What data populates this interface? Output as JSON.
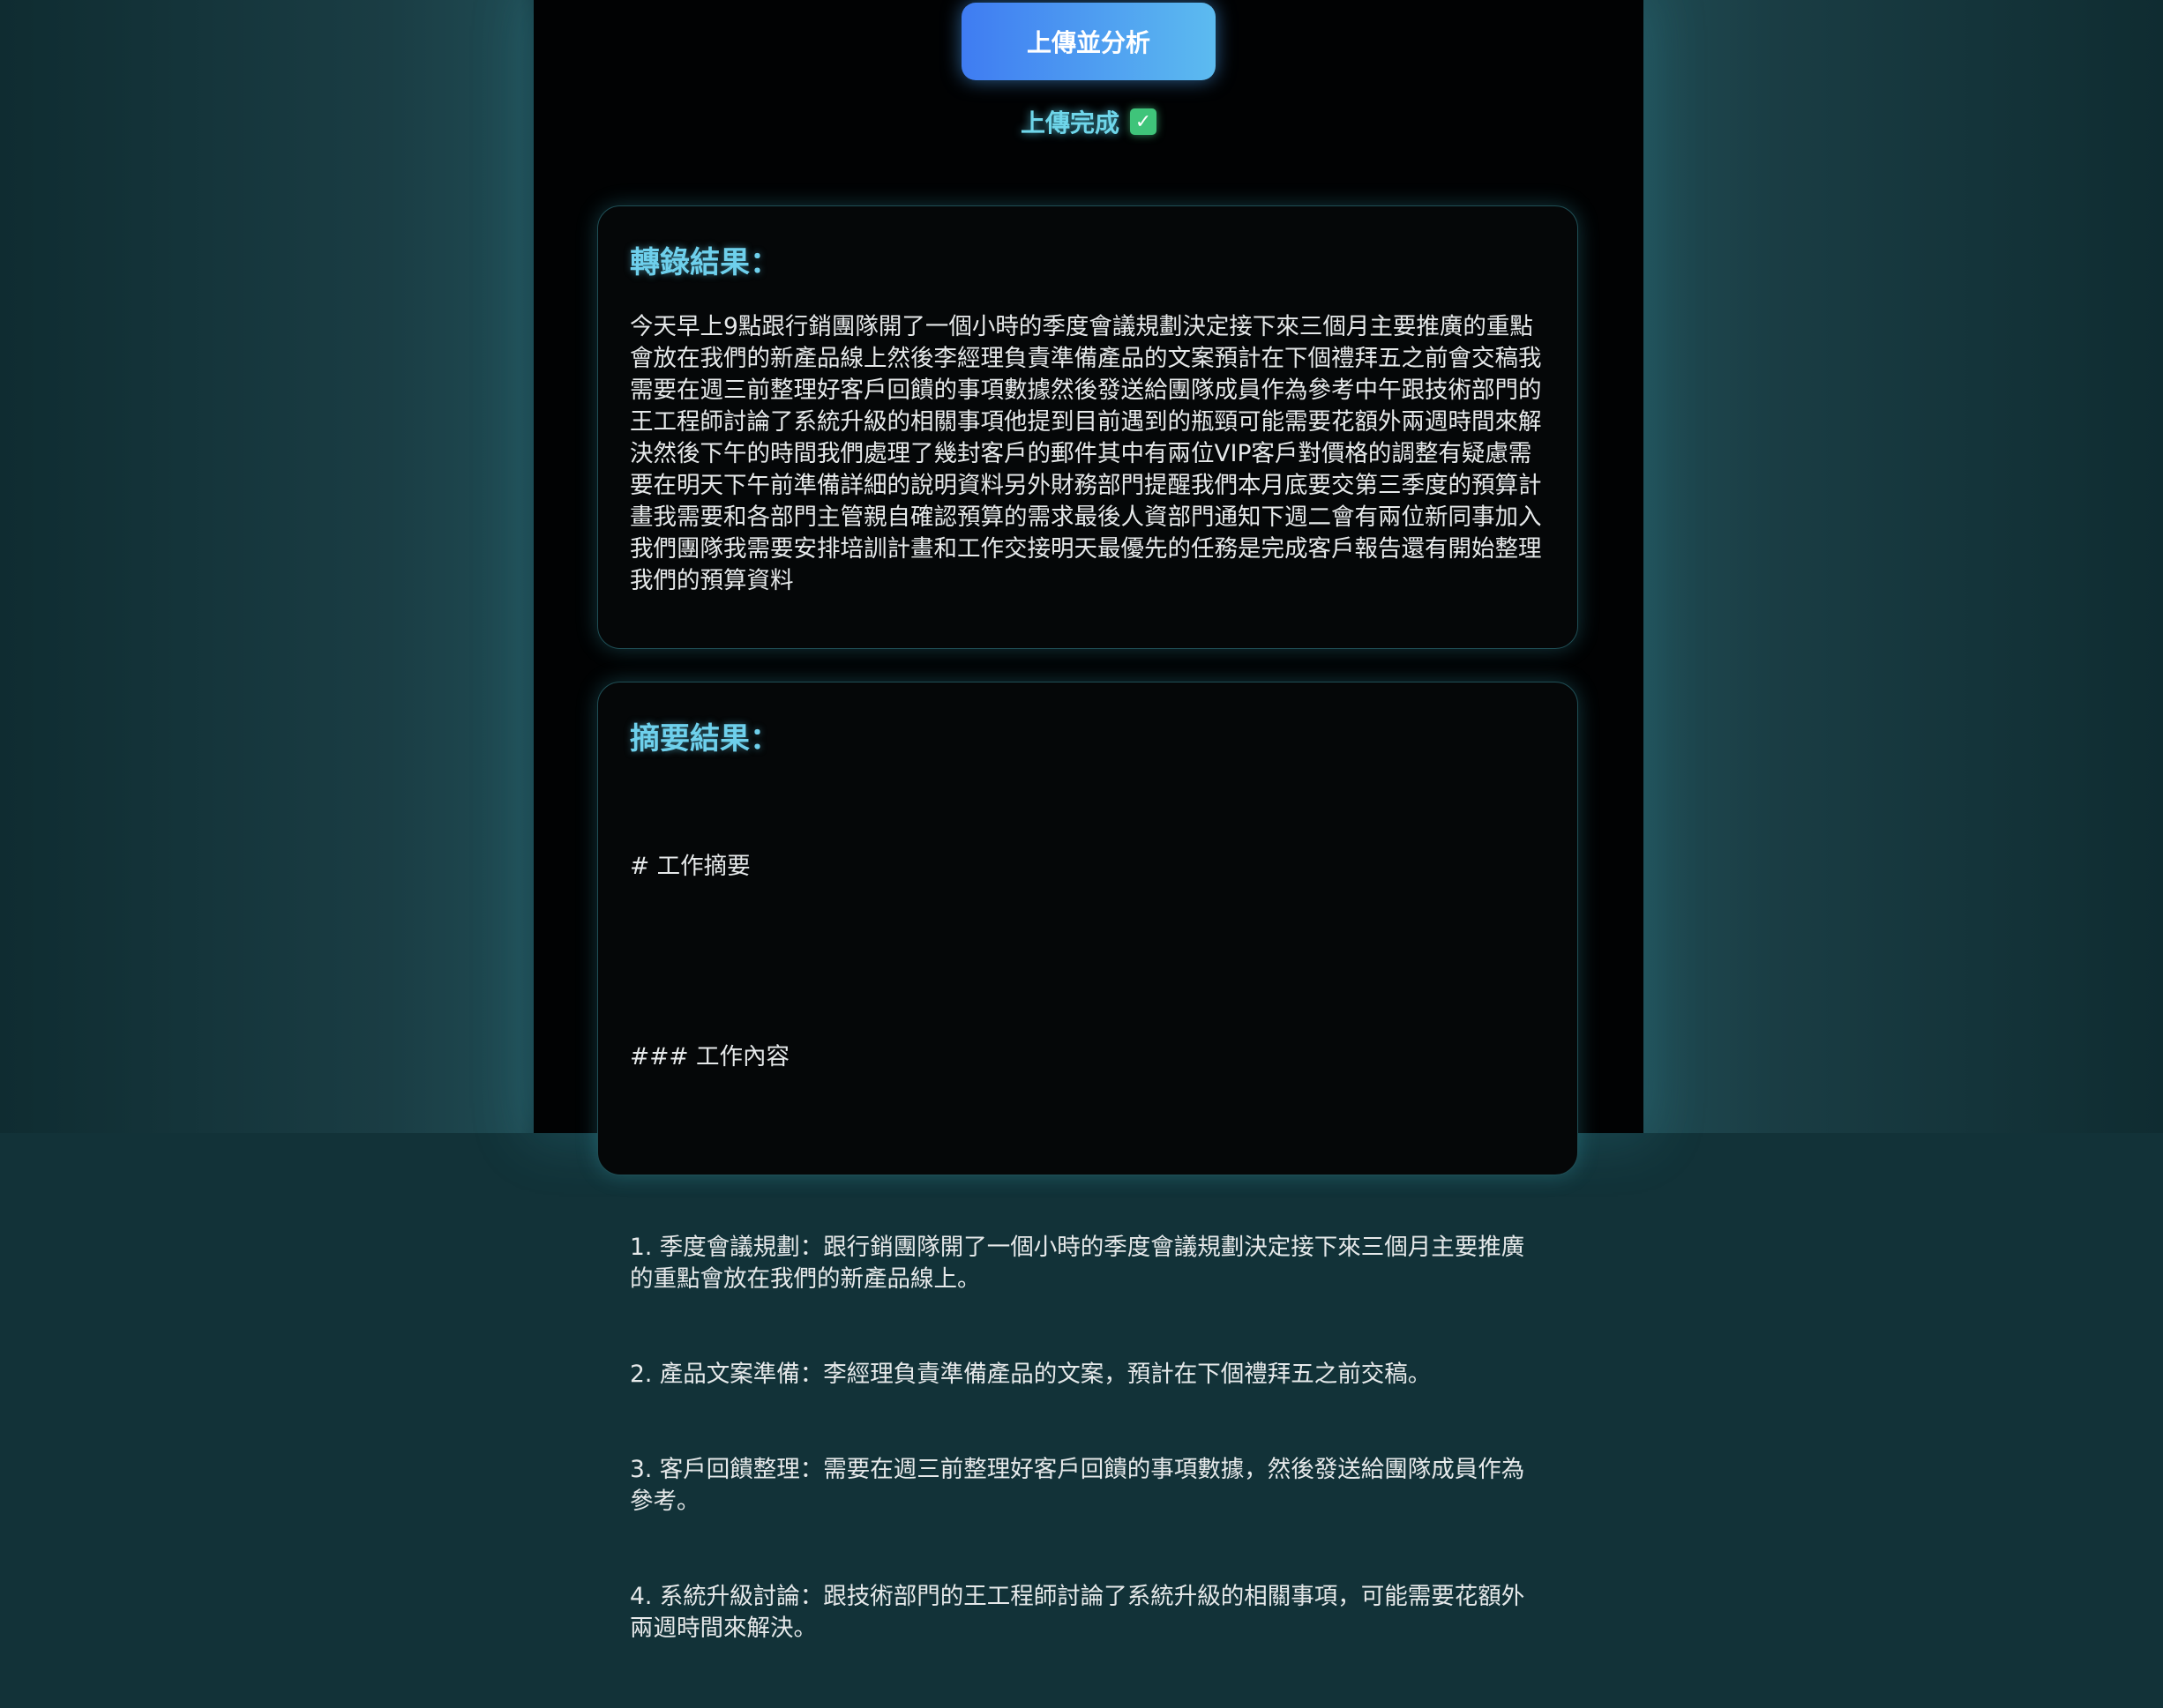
{
  "upload": {
    "button_label": "上傳並分析",
    "status_text": "上傳完成",
    "status_icon": "check-box-icon",
    "status_icon_glyph": "✓"
  },
  "transcript": {
    "title": "轉錄結果：",
    "text": "今天早上9點跟行銷團隊開了一個小時的季度會議規劃決定接下來三個月主要推廣的重點會放在我們的新產品線上然後李經理負責準備產品的文案預計在下個禮拜五之前會交稿我需要在週三前整理好客戶回饋的事項數據然後發送給團隊成員作為參考中午跟技術部門的王工程師討論了系統升級的相關事項他提到目前遇到的瓶頸可能需要花額外兩週時間來解決然後下午的時間我們處理了幾封客戶的郵件其中有兩位VIP客戶對價格的調整有疑慮需要在明天下午前準備詳細的說明資料另外財務部門提醒我們本月底要交第三季度的預算計畫我需要和各部門主管親自確認預算的需求最後人資部門通知下週二會有兩位新同事加入我們團隊我需要安排培訓計畫和工作交接明天最優先的任務是完成客戶報告還有開始整理我們的預算資料"
  },
  "summary": {
    "title": "摘要結果：",
    "heading": "# 工作摘要",
    "subheading": "### 工作內容",
    "items": [
      "1. 季度會議規劃：跟行銷團隊開了一個小時的季度會議規劃決定接下來三個月主要推廣的重點會放在我們的新產品線上。",
      "2. 產品文案準備：李經理負責準備產品的文案，預計在下個禮拜五之前交稿。",
      "3. 客戶回饋整理：需要在週三前整理好客戶回饋的事項數據，然後發送給團隊成員作為參考。",
      "4. 系統升級討論：跟技術部門的王工程師討論了系統升級的相關事項，可能需要花額外兩週時間來解決。"
    ]
  },
  "colors": {
    "accent": "#6ed0ec",
    "button_start": "#3f7cf2",
    "button_end": "#5cbbf0",
    "check": "#3fc47a"
  }
}
